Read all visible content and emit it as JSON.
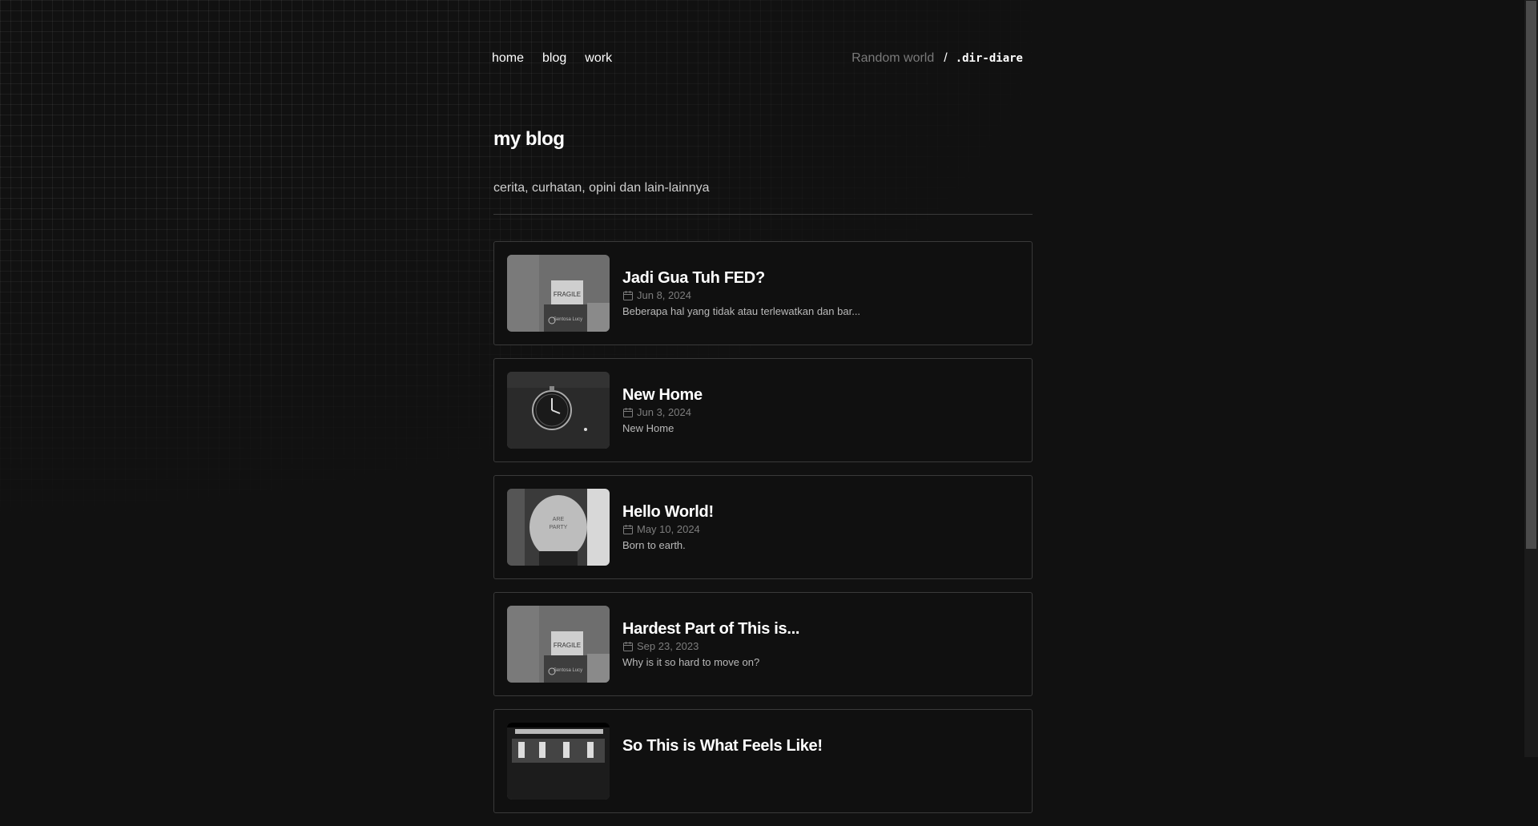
{
  "nav": {
    "links": [
      "home",
      "blog",
      "work"
    ],
    "brand_random": "Random world",
    "brand_sep": "/",
    "brand_name": ".dir-diare"
  },
  "header": {
    "title": "my blog",
    "subtitle": "cerita, curhatan, opini dan lain-lainnya"
  },
  "posts": [
    {
      "title": "Jadi Gua Tuh FED?",
      "date": "Jun 8, 2024",
      "excerpt": "Beberapa hal yang tidak atau terlewatkan dan bar...",
      "thumb": "fragile-box"
    },
    {
      "title": "New Home",
      "date": "Jun 3, 2024",
      "excerpt": "New Home",
      "thumb": "clock"
    },
    {
      "title": "Hello World!",
      "date": "May 10, 2024",
      "excerpt": "Born to earth.",
      "thumb": "person-back"
    },
    {
      "title": "Hardest Part of This is...",
      "date": "Sep 23, 2023",
      "excerpt": "Why is it so hard to move on?",
      "thumb": "fragile-box"
    },
    {
      "title": "So This is What Feels Like!",
      "date": "",
      "excerpt": "",
      "thumb": "room"
    }
  ]
}
